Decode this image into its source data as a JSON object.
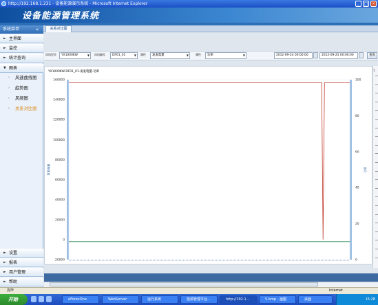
{
  "window": {
    "title": "http://192.168.1.231 - 设备能源演示系统 - Microsoft Internet Explorer",
    "minimize": "_",
    "maximize": "□",
    "close": "×"
  },
  "app": {
    "title": "设备能源管理系统"
  },
  "sidebar": {
    "header": "系统菜单",
    "collapse": "«",
    "items_top": [
      {
        "label": "主界面"
      },
      {
        "label": "监控"
      },
      {
        "label": "统计查询"
      },
      {
        "label": "图表"
      }
    ],
    "sub_items": [
      {
        "label": "风速曲线图",
        "active": false
      },
      {
        "label": "趋势图",
        "active": false
      },
      {
        "label": "风频图",
        "active": false
      },
      {
        "label": "关系对比图",
        "active": true
      }
    ],
    "items_bottom": [
      {
        "label": "设置"
      },
      {
        "label": "报表"
      },
      {
        "label": "用户管理"
      },
      {
        "label": "帮助"
      }
    ]
  },
  "tab": {
    "label": "关系对比图"
  },
  "filters": {
    "model_label": "风机型号",
    "model_value": "YX1000KW",
    "device_label": "风机编号",
    "device_value": "DF01_01",
    "attr1_label": "属性",
    "attr1_value": "发发电量",
    "attr2_label": "属性",
    "attr2_value": "功率",
    "start_date": "2012-09-24 00:00:00",
    "end_date": "2012-09-25 00:00:00",
    "query_button": "查询"
  },
  "chart_data": {
    "type": "line",
    "title": "YX1000KW-DF01_01-发发电量-功率",
    "y_left": {
      "label": "发发电量",
      "range": [
        -20000,
        160000
      ],
      "ticks": [
        "160000",
        "140000",
        "120000",
        "100000",
        "80000",
        "60000",
        "40000",
        "20000",
        "0",
        "-20000"
      ]
    },
    "y_right": {
      "label": "功率",
      "range": [
        0,
        100
      ],
      "ticks": [
        "100",
        "80",
        "60",
        "40",
        "20",
        "0"
      ]
    },
    "series": [
      {
        "name": "发发电量",
        "axis": "left",
        "color": "#c0392b",
        "points": [
          [
            0,
            157000
          ],
          [
            0.9,
            157000
          ],
          [
            0.905,
            60
          ],
          [
            0.91,
            157000
          ],
          [
            1,
            157000
          ]
        ]
      },
      {
        "name": "功率",
        "axis": "right",
        "color": "#2e8b57",
        "points": [
          [
            0,
            10
          ],
          [
            1,
            10
          ]
        ]
      }
    ]
  },
  "right_strip": {
    "label": "1"
  },
  "status": {
    "text": "完毕",
    "zone": "Internet"
  },
  "taskbar": {
    "start": "开始",
    "tasks": [
      {
        "label": "eForexOne"
      },
      {
        "label": "WebServer"
      },
      {
        "label": "运行系统"
      },
      {
        "label": "能源管理平台..."
      },
      {
        "label": "http://192.1..."
      },
      {
        "label": "5.bmp - 画图"
      },
      {
        "label": "桌面"
      }
    ],
    "clock": "15:28"
  }
}
